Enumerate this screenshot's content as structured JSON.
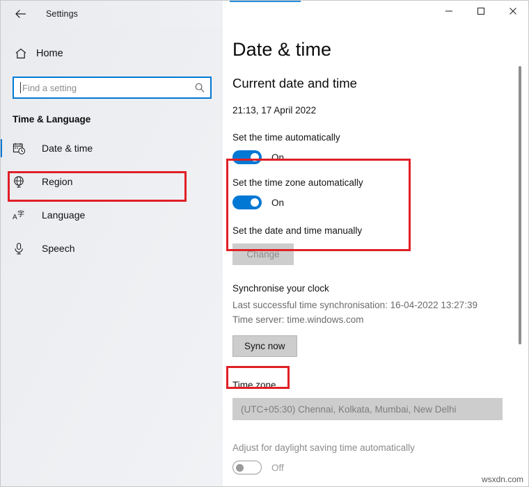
{
  "window": {
    "title": "Settings",
    "back_icon": "back-arrow-icon",
    "minimize_label": "─",
    "maximize_label": "□",
    "close_label": "✕"
  },
  "sidebar": {
    "home_label": "Home",
    "home_icon": "home-icon",
    "search": {
      "placeholder": "Find a setting",
      "value": "",
      "icon": "search-icon"
    },
    "category_title": "Time & Language",
    "items": [
      {
        "label": "Date & time",
        "icon": "calendar-clock-icon",
        "selected": true
      },
      {
        "label": "Region",
        "icon": "globe-icon",
        "selected": false
      },
      {
        "label": "Language",
        "icon": "language-icon",
        "selected": false
      },
      {
        "label": "Speech",
        "icon": "microphone-icon",
        "selected": false
      }
    ]
  },
  "main": {
    "page_title": "Date & time",
    "current_section_heading": "Current date and time",
    "current_datetime": "21:13, 17 April 2022",
    "set_time_auto": {
      "label": "Set the time automatically",
      "state": "On",
      "enabled": true
    },
    "set_timezone_auto": {
      "label": "Set the time zone automatically",
      "state": "On",
      "enabled": true
    },
    "manual": {
      "label": "Set the date and time manually",
      "button_label": "Change",
      "button_enabled": false
    },
    "sync": {
      "heading": "Synchronise your clock",
      "last_sync": "Last successful time synchronisation: 16-04-2022 13:27:39",
      "time_server": "Time server: time.windows.com",
      "button_label": "Sync now",
      "button_enabled": true
    },
    "timezone": {
      "label": "Time zone",
      "selected": "(UTC+05:30) Chennai, Kolkata, Mumbai, New Delhi",
      "enabled": false
    },
    "dst": {
      "label": "Adjust for daylight saving time automatically",
      "state": "Off",
      "enabled": false
    }
  },
  "annotations": {
    "accent_color": "#e01f26",
    "highlight_sidebar_item": "Date & time",
    "highlight_toggles": "Set the time automatically / Set the time zone automatically",
    "highlight_button": "Sync now"
  },
  "watermark": "wsxdn.com",
  "colors": {
    "accent_blue": "#0078d4",
    "annotation_red": "#e01f26",
    "disabled_gray": "#cdcdcd"
  }
}
